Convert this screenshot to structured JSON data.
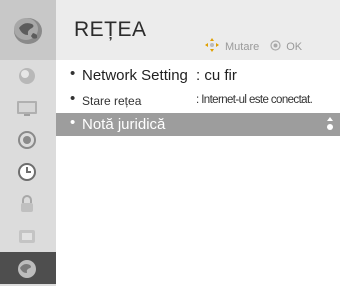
{
  "header": {
    "title": "REȚEA",
    "hint_move": "Mutare",
    "hint_ok": "OK"
  },
  "menu": {
    "items": [
      {
        "label": "Network Setting",
        "value": ": cu fir"
      },
      {
        "label": "Stare rețea",
        "value": ": Internet-ul este conectat."
      },
      {
        "label": "Notă juridică",
        "value": ""
      }
    ]
  },
  "rail": {
    "icons": [
      "network-globe-icon",
      "picture-icon",
      "screen-icon",
      "audio-icon",
      "time-icon",
      "lock-icon",
      "option-icon",
      "network-icon"
    ],
    "active_index": 7
  },
  "colors": {
    "rail_bg": "#dcdcdc",
    "header_bg": "#ececec",
    "selected_row": "#9d9d9d",
    "active_rail": "#4e4e4e"
  }
}
